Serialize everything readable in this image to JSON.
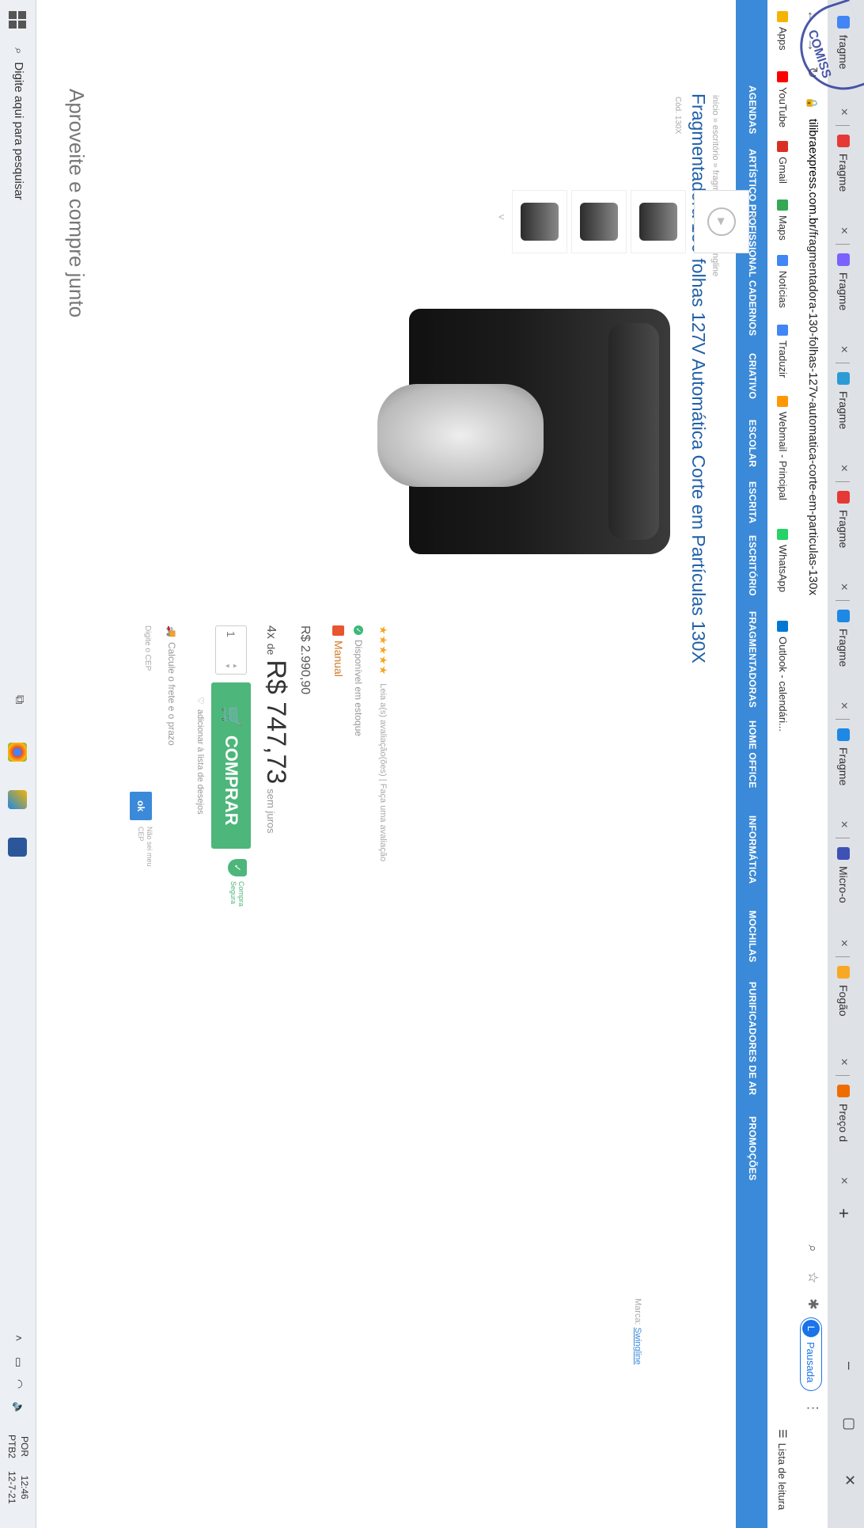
{
  "browser": {
    "tabs": [
      {
        "label": "fragme",
        "color": "#4285f4"
      },
      {
        "label": "Fragme",
        "color": "#e53935"
      },
      {
        "label": "Fragme",
        "color": "#7b61ff"
      },
      {
        "label": "Fragme",
        "color": "#2b9bd6"
      },
      {
        "label": "Fragme",
        "color": "#e53935"
      },
      {
        "label": "Fragme",
        "color": "#1e88e5"
      },
      {
        "label": "Fragme",
        "color": "#1e88e5"
      },
      {
        "label": "Micro-o",
        "color": "#3f51b5"
      },
      {
        "label": "Fogão",
        "color": "#f9a825"
      },
      {
        "label": "Preço d",
        "color": "#ef6c00"
      }
    ],
    "new_tab": "+",
    "close_glyph": "×",
    "url_host": "tilibraexpress.com.br",
    "url_path": "/fragmentadora-130-folhas-127v-automatica-corte-em-particulas-130x",
    "profile_initial": "L",
    "profile_status": "Pausada",
    "bookmarks": [
      {
        "label": "Apps",
        "color": "#f4b400"
      },
      {
        "label": "YouTube",
        "color": "#ff0000"
      },
      {
        "label": "Gmail",
        "color": "#d93025"
      },
      {
        "label": "Maps",
        "color": "#34a853"
      },
      {
        "label": "Notícias",
        "color": "#4285f4"
      },
      {
        "label": "Traduzir",
        "color": "#4285f4"
      },
      {
        "label": "Webmail - Principal",
        "color": "#ff9800"
      },
      {
        "label": "WhatsApp",
        "color": "#25d366"
      },
      {
        "label": "Outlook - calendári...",
        "color": "#0078d4"
      }
    ],
    "reading_list": "Lista de leitura"
  },
  "site": {
    "categories": [
      "AGENDAS",
      "ARTÍSTICO PROFISSIONAL",
      "CADERNOS",
      "CRIATIVO",
      "ESCOLAR",
      "ESCRITA",
      "ESCRITÓRIO",
      "FRAGMENTADORAS",
      "HOME OFFICE",
      "INFORMÁTICA",
      "MOCHILAS",
      "PURIFICADORES DE AR",
      "PROMOÇÕES"
    ],
    "accent": "#3b8ad9",
    "buy_color": "#4db67a"
  },
  "product": {
    "breadcrumb": "início » escritório » fragmentadoras » swingline",
    "title": "Fragmentadora 130 folhas 127V Automática Corte em Partículas 130X",
    "brand_line": "Cód. 130X",
    "video_label": "VÍDEO",
    "rating_stars": "★★★★★",
    "rating_text": "Leia a(s) avaliação(ões) | Faça uma avaliação",
    "stock": "Disponível em estoque",
    "manual": "Manual",
    "price": "R$ 2.990,90",
    "installment_count": "4x",
    "installment_de": "de",
    "installment_value": "R$ 747,73",
    "installment_suffix": "sem juros",
    "quantity": "1",
    "buy_label": "COMPRAR",
    "secure_label": "Compra Segura",
    "wishlist": "adicionar à lista de desejos",
    "shipping": "Calcule o frete e o prazo",
    "cep_placeholder": "Digite o CEP",
    "ok_label": "ok",
    "no_cep": "Não sei meu CEP",
    "brand_label": "Marca:",
    "brand_name": "Swingline"
  },
  "section_title": "Aproveite e compre junto",
  "taskbar": {
    "search": "Digite aqui para pesquisar",
    "lang1": "POR",
    "lang2": "PTB2",
    "time": "12:46",
    "date": "12-7-21"
  },
  "stamp_text": "COMISSÃO DE L"
}
